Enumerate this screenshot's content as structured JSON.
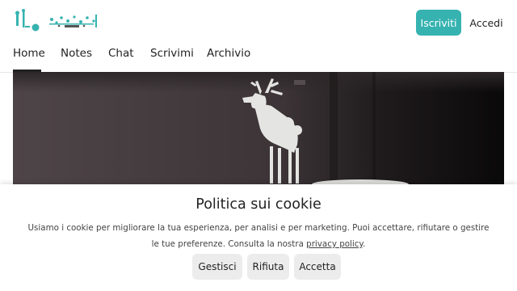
{
  "header": {
    "subscribe_label": "Iscriviti",
    "login_label": "Accedi",
    "accent_color": "#36b3b0"
  },
  "nav": {
    "items": [
      {
        "label": "Home",
        "active": true
      },
      {
        "label": "Notes"
      },
      {
        "label": "Chat"
      },
      {
        "label": "Scrivimi"
      },
      {
        "label": "Archivio"
      }
    ]
  },
  "cookie": {
    "title": "Politica sui cookie",
    "text_before_link": "Usiamo i cookie per migliorare la tua esperienza, per analisi e per marketing. Puoi accettare, rifiutare o gestire le tue preferenze. Consulta la nostra ",
    "link_label": "privacy policy",
    "text_after_link": ".",
    "manage_label": "Gestisci",
    "reject_label": "Rifiuta",
    "accept_label": "Accetta"
  }
}
